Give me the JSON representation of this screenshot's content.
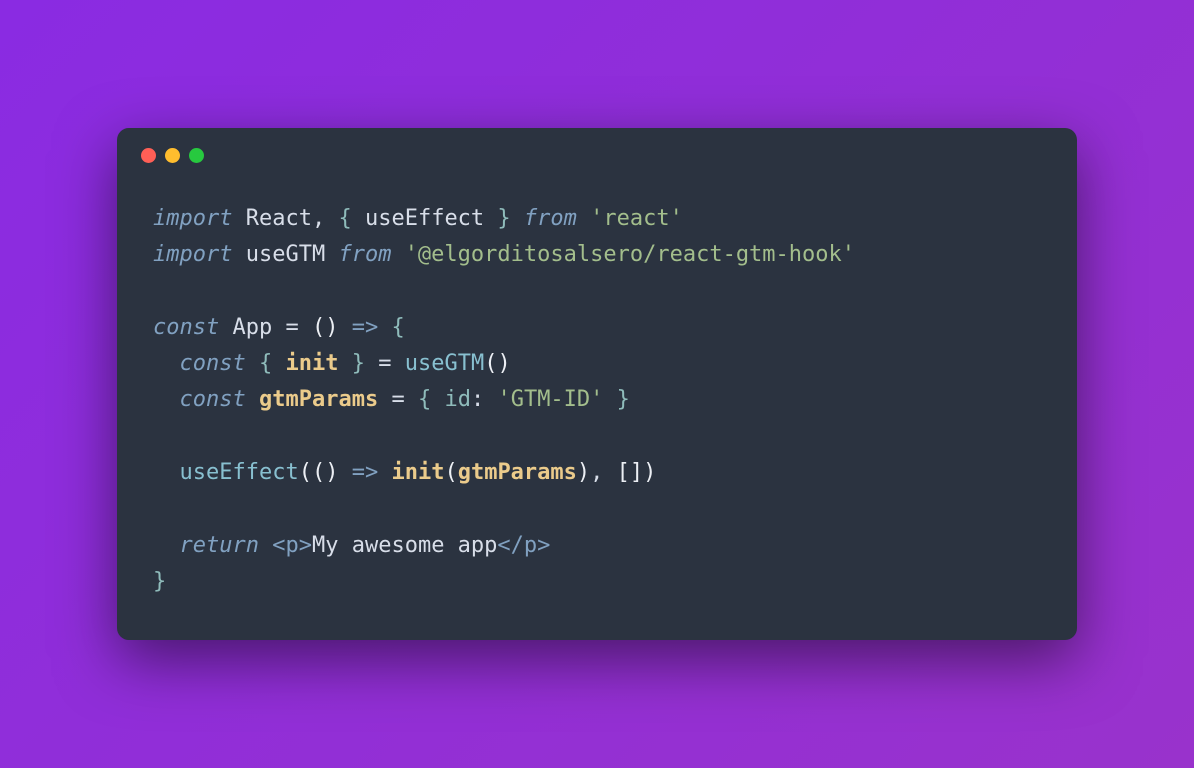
{
  "code": {
    "line1": {
      "import": "import",
      "react": "React",
      "comma": ", ",
      "lbrace": "{ ",
      "useEffect": "useEffect",
      "rbrace": " }",
      "from": " from ",
      "pkg": "'react'"
    },
    "line2": {
      "import": "import",
      "useGTM": " useGTM ",
      "from": "from ",
      "pkg": "'@elgorditosalsero/react-gtm-hook'"
    },
    "line4": {
      "const": "const",
      "app": " App ",
      "eq": "= ",
      "paren": "() ",
      "arrow": "=> ",
      "brace": "{"
    },
    "line5": {
      "indent": "  ",
      "const": "const",
      "lbrace": " { ",
      "init": "init",
      "rbrace": " } ",
      "eq": "= ",
      "call": "useGTM",
      "parens": "()"
    },
    "line6": {
      "indent": "  ",
      "const": "const",
      "sp": " ",
      "gtmParams": "gtmParams",
      "eq": " = ",
      "lbrace": "{ ",
      "id": "id",
      "colon": ": ",
      "val": "'GTM-ID'",
      "rbrace": " }"
    },
    "line8": {
      "indent": "  ",
      "call": "useEffect",
      "lp1": "(",
      "lp2": "() ",
      "arrow": "=> ",
      "init": "init",
      "lp3": "(",
      "gtmParams": "gtmParams",
      "rp3": ")",
      "comma": ", ",
      "arr": "[]",
      "rp1": ")"
    },
    "line10": {
      "indent": "  ",
      "return": "return",
      "sp": " ",
      "open": "<p>",
      "txt": "My awesome app",
      "close": "</p>"
    },
    "line11": {
      "brace": "}"
    }
  }
}
